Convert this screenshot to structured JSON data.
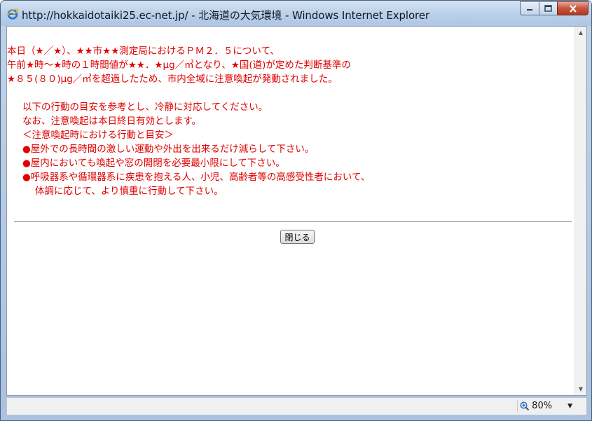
{
  "window": {
    "title": "http://hokkaidotaiki25.ec-net.jp/ - 北海道の大気環境 - Windows Internet Explorer",
    "controls": {
      "minimize_icon": "minimize-icon",
      "maximize_icon": "maximize-icon",
      "close_icon": "close-icon"
    }
  },
  "message": {
    "lines": [
      "本日（★／★）、★★市★★測定局におけるＰＭ２．５について、",
      "午前★時～★時の１時間値が★★．★μg／㎥となり、★国(道)が定めた判断基準の",
      "★８５(８０)μg／㎥を超過したため、市内全域に注意喚起が発動されました。"
    ],
    "guidance": [
      "以下の行動の目安を参考とし、冷静に対応してください。",
      "なお、注意喚起は本日終日有効とします。",
      "＜注意喚起時における行動と目安＞",
      "●屋外での長時間の激しい運動や外出を出来るだけ減らして下さい。",
      "●屋内においても喚起や窓の開閉を必要最小限にして下さい。",
      "●呼吸器系や循環器系に疾患を抱える人、小児、高齢者等の高感受性者において、"
    ],
    "continuation": "体調に応じて、より慎重に行動して下さい。"
  },
  "close_button": {
    "label": "閉じる"
  },
  "statusbar": {
    "zoom": "80%"
  },
  "colors": {
    "message_text": "#e00000",
    "titlebar": "#bcd1ea"
  }
}
